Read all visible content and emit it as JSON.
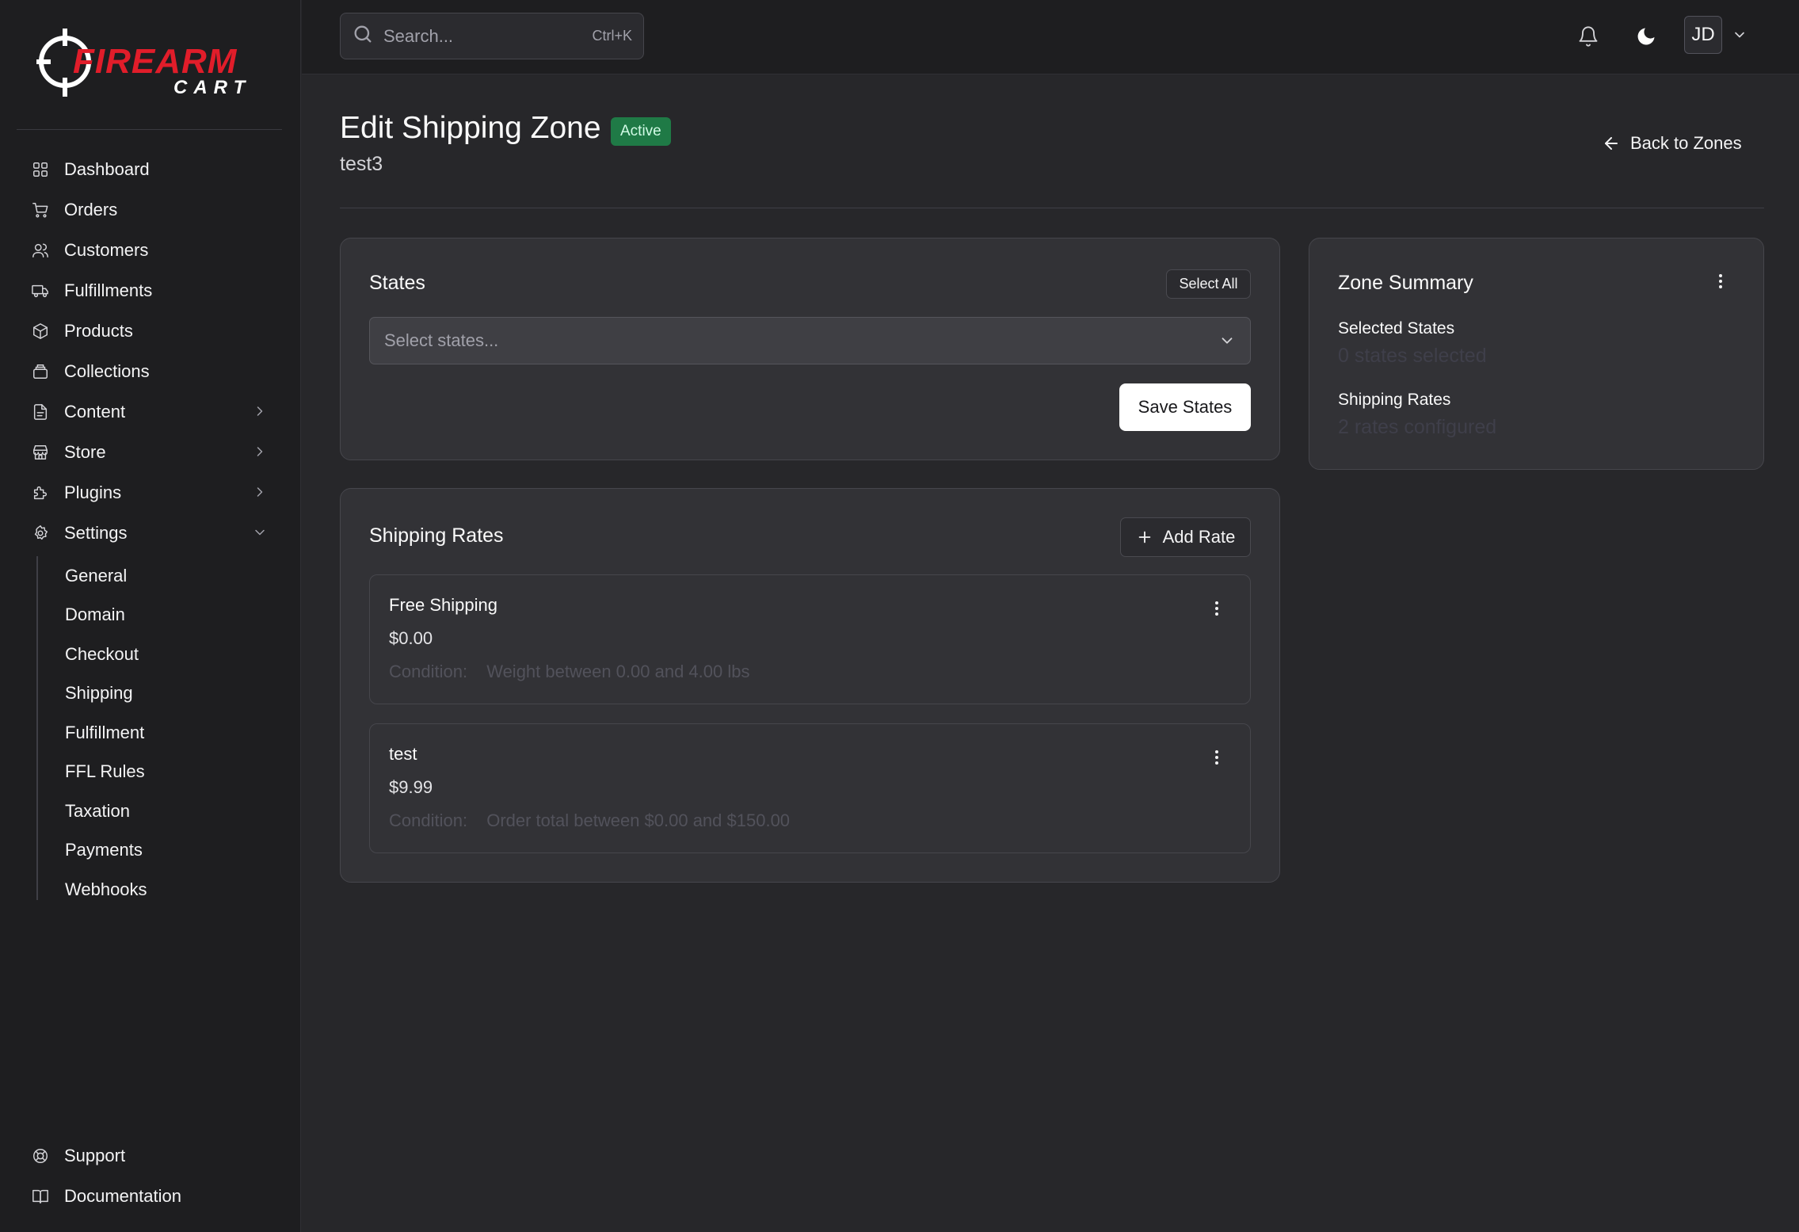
{
  "brand": {
    "name_top": "FIREARM",
    "name_bottom": "CART",
    "accent": "#e11d2a"
  },
  "sidebar": {
    "items": [
      {
        "label": "Dashboard",
        "icon": "grid-icon"
      },
      {
        "label": "Orders",
        "icon": "cart-icon"
      },
      {
        "label": "Customers",
        "icon": "users-icon"
      },
      {
        "label": "Fulfillments",
        "icon": "truck-icon"
      },
      {
        "label": "Products",
        "icon": "box-icon"
      },
      {
        "label": "Collections",
        "icon": "archive-icon"
      },
      {
        "label": "Content",
        "icon": "file-icon"
      },
      {
        "label": "Store",
        "icon": "store-icon"
      },
      {
        "label": "Plugins",
        "icon": "puzzle-icon"
      },
      {
        "label": "Settings",
        "icon": "gear-icon"
      }
    ],
    "settings_sub": [
      "General",
      "Domain",
      "Checkout",
      "Shipping",
      "Fulfillment",
      "FFL Rules",
      "Taxation",
      "Payments",
      "Webhooks"
    ],
    "bottom": [
      {
        "label": "Support",
        "icon": "lifebuoy-icon"
      },
      {
        "label": "Documentation",
        "icon": "book-icon"
      }
    ]
  },
  "topbar": {
    "search_placeholder": "Search...",
    "search_shortcut": "Ctrl+K",
    "avatar_initials": "JD"
  },
  "page": {
    "title": "Edit Shipping Zone",
    "status": "Active",
    "zone_name": "test3",
    "back_label": "Back to Zones"
  },
  "states_card": {
    "title": "States",
    "select_all_label": "Select All",
    "select_placeholder": "Select states...",
    "save_label": "Save States"
  },
  "rates_card": {
    "title": "Shipping Rates",
    "add_label": "Add Rate",
    "condition_label": "Condition:",
    "rates": [
      {
        "name": "Free Shipping",
        "price": "$0.00",
        "condition": "Weight between 0.00 and 4.00 lbs"
      },
      {
        "name": "test",
        "price": "$9.99",
        "condition": "Order total between $0.00 and $150.00"
      }
    ]
  },
  "summary_card": {
    "title": "Zone Summary",
    "selected_states_label": "Selected States",
    "selected_states_value": "0 states selected",
    "shipping_rates_label": "Shipping Rates",
    "shipping_rates_value": "2 rates configured"
  }
}
